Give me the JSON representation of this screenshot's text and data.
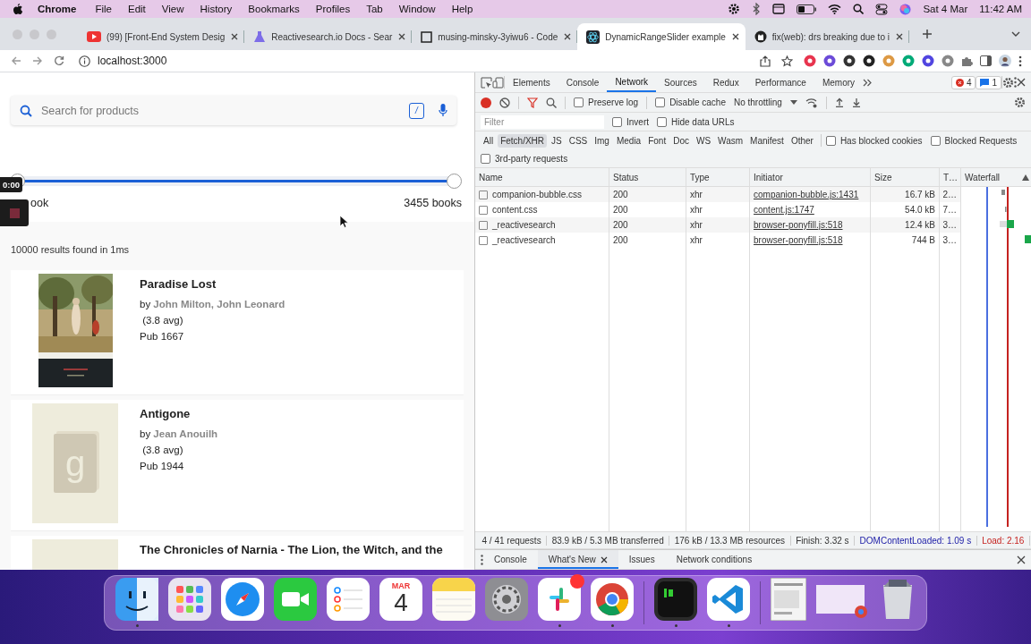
{
  "menu_bar": {
    "app": "Chrome",
    "menus": [
      "File",
      "Edit",
      "View",
      "History",
      "Bookmarks",
      "Profiles",
      "Tab",
      "Window",
      "Help"
    ],
    "date": "Sat 4 Mar",
    "time": "11:42 AM"
  },
  "tabs": [
    {
      "title": "(99) [Front-End System Desig",
      "selected": false
    },
    {
      "title": "Reactivesearch.io Docs - Sear",
      "selected": false
    },
    {
      "title": "musing-minsky-3yiwu6 - Code",
      "selected": false
    },
    {
      "title": "DynamicRangeSlider example",
      "selected": true
    },
    {
      "title": "fix(web): drs breaking due to i",
      "selected": false
    }
  ],
  "address_bar": {
    "url": "localhost:3000"
  },
  "page": {
    "search": {
      "placeholder": "Search for products",
      "shortcut": "/"
    },
    "range": {
      "level": 1,
      "start_label": "ook",
      "end_label": "3455 books"
    },
    "recorder": {
      "time": "0:00"
    },
    "result_stats": "10000 results found in 1ms",
    "books": [
      {
        "title": "Paradise Lost",
        "by": "by",
        "authors": "John Milton, John Leonard",
        "rating": "(3.8 avg)",
        "published": "Pub 1667",
        "kind": "picture"
      },
      {
        "title": "Antigone",
        "by": "by",
        "authors": "Jean Anouilh",
        "rating": "(3.8 avg)",
        "published": "Pub 1944",
        "kind": "placeholder",
        "cover_mark": "g"
      },
      {
        "title": "The Chronicles of Narnia - The Lion, the Witch, and the",
        "kind": "placeholder"
      }
    ]
  },
  "devtools": {
    "tabs": [
      {
        "label": "Elements",
        "selected": false
      },
      {
        "label": "Console",
        "selected": false
      },
      {
        "label": "Network",
        "selected": true
      },
      {
        "label": "Sources",
        "selected": false
      },
      {
        "label": "Redux",
        "selected": false
      },
      {
        "label": "Performance",
        "selected": false
      },
      {
        "label": "Memory",
        "selected": false
      }
    ],
    "error_count": "4",
    "message_count": "1",
    "recording": true,
    "options": [
      {
        "label": "Preserve log",
        "checked": false
      },
      {
        "label": "Disable cache",
        "checked": false
      }
    ],
    "throttling": "No throttling",
    "filter": {
      "placeholder": "Filter"
    },
    "filter_options": [
      {
        "label": "Invert",
        "checked": false
      },
      {
        "label": "Hide data URLs",
        "checked": false
      }
    ],
    "type_filters": [
      {
        "label": "All",
        "selected": false
      },
      {
        "label": "Fetch/XHR",
        "selected": true
      },
      {
        "label": "JS",
        "selected": false
      },
      {
        "label": "CSS",
        "selected": false
      },
      {
        "label": "Img",
        "selected": false
      },
      {
        "label": "Media",
        "selected": false
      },
      {
        "label": "Font",
        "selected": false
      },
      {
        "label": "Doc",
        "selected": false
      },
      {
        "label": "WS",
        "selected": false
      },
      {
        "label": "Wasm",
        "selected": false
      },
      {
        "label": "Manifest",
        "selected": false
      },
      {
        "label": "Other",
        "selected": false
      }
    ],
    "blocking_options": [
      {
        "label": "Has blocked cookies",
        "checked": false
      },
      {
        "label": "Blocked Requests",
        "checked": false
      }
    ],
    "third_party": {
      "label": "3rd-party requests",
      "checked": false
    },
    "columns": [
      "Name",
      "Status",
      "Type",
      "Initiator",
      "Size",
      "T…",
      "Waterfall"
    ],
    "rows": [
      {
        "name": "companion-bubble.css",
        "status": "200",
        "type": "xhr",
        "initiator": "companion-bubble.js:1431",
        "size": "16.7 kB",
        "time": "2…"
      },
      {
        "name": "content.css",
        "status": "200",
        "type": "xhr",
        "initiator": "content.js:1747",
        "size": "54.0 kB",
        "time": "7…"
      },
      {
        "name": "_reactivesearch",
        "status": "200",
        "type": "xhr",
        "initiator": "browser-ponyfill.js:518",
        "size": "12.4 kB",
        "time": "3…"
      },
      {
        "name": "_reactivesearch",
        "status": "200",
        "type": "xhr",
        "initiator": "browser-ponyfill.js:518",
        "size": "744 B",
        "time": "3…"
      }
    ],
    "summary": [
      {
        "text": "4 / 41 requests",
        "kind": "plain"
      },
      {
        "text": "83.9 kB / 5.3 MB transferred",
        "kind": "plain"
      },
      {
        "text": "176 kB / 13.3 MB resources",
        "kind": "plain"
      },
      {
        "text": "Finish: 3.32 s",
        "kind": "plain"
      },
      {
        "text": "DOMContentLoaded: 1.09 s",
        "kind": "dom"
      },
      {
        "text": "Load: 2.16",
        "kind": "load"
      }
    ],
    "drawer_tabs": [
      {
        "label": "Console",
        "selected": false,
        "closable": false
      },
      {
        "label": "What's New",
        "selected": true,
        "closable": true
      },
      {
        "label": "Issues",
        "selected": false,
        "closable": false
      },
      {
        "label": "Network conditions",
        "selected": false,
        "closable": false
      }
    ]
  },
  "dock": {
    "apps": [
      {
        "kind": "finder",
        "running": true
      },
      {
        "kind": "launchpad",
        "running": false
      },
      {
        "kind": "safari",
        "running": false
      },
      {
        "kind": "facetime",
        "running": false
      },
      {
        "kind": "reminders",
        "running": false
      },
      {
        "kind": "calendar",
        "running": false,
        "month": "MAR",
        "day": "4"
      },
      {
        "kind": "notes",
        "running": false
      },
      {
        "kind": "settings",
        "running": false
      },
      {
        "kind": "slack",
        "running": true,
        "badge": true
      },
      {
        "kind": "chrome",
        "running": true
      },
      {
        "kind": "separator"
      },
      {
        "kind": "terminal",
        "running": true
      },
      {
        "kind": "vscode",
        "running": true
      },
      {
        "kind": "separator"
      },
      {
        "kind": "window",
        "running": false
      },
      {
        "kind": "window_chrome",
        "running": false
      },
      {
        "kind": "trash",
        "running": false
      }
    ]
  }
}
